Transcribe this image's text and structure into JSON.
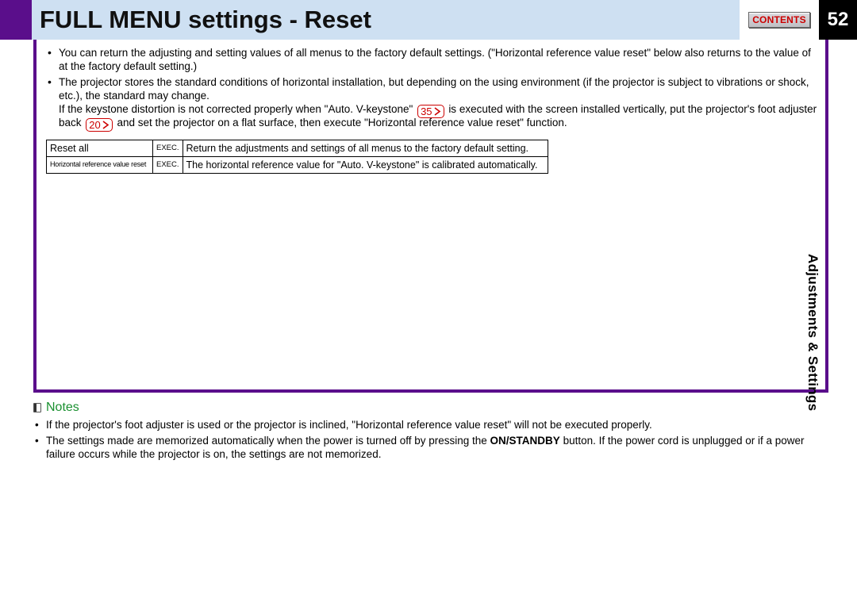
{
  "header": {
    "title": "FULL MENU settings - Reset",
    "contents_label": "CONTENTS",
    "page_number": "52"
  },
  "side_label": "Adjustments & Settings",
  "body": {
    "bullets": [
      {
        "pre": "You can return the adjusting and setting values of all menus to the factory default settings. (\"Horizontal reference value reset\" below also returns to the value of at the factory default setting.)"
      },
      {
        "pre": "The projector stores the standard conditions of horizontal installation, but depending on the using environment (if the projector is subject to vibrations or shock, etc.), the standard may change.",
        "line2_pre": "If the keystone distortion is not corrected properly when \"Auto. V-keystone\" ",
        "badge1": "35",
        "line2_mid": " is executed with the screen installed vertically, put the projector's foot adjuster back ",
        "badge2": "20",
        "line2_post": " and set the projector on a flat surface, then execute \"Horizontal reference value reset\" function."
      }
    ],
    "table": {
      "rows": [
        {
          "c1": "Reset all",
          "c2": "EXEC.",
          "c3": "Return the adjustments and settings of all menus to the factory default setting.",
          "c1_small": false
        },
        {
          "c1": "Horizontal reference value reset",
          "c2": "EXEC.",
          "c3": "The horizontal reference value for \"Auto. V-keystone\" is calibrated automatically.",
          "c1_small": true
        }
      ]
    }
  },
  "notes": {
    "heading": "Notes",
    "items": [
      {
        "text": "If the projector's foot adjuster is used or the projector is inclined, \"Horizontal reference value reset\" will not be executed properly."
      },
      {
        "pre": "The settings made are memorized automatically when the power is turned off by pressing the ",
        "bold": "ON/STANDBY",
        "post": " button. If the power cord is unplugged or if a power failure occurs while the projector is on, the settings are not memorized."
      }
    ]
  }
}
